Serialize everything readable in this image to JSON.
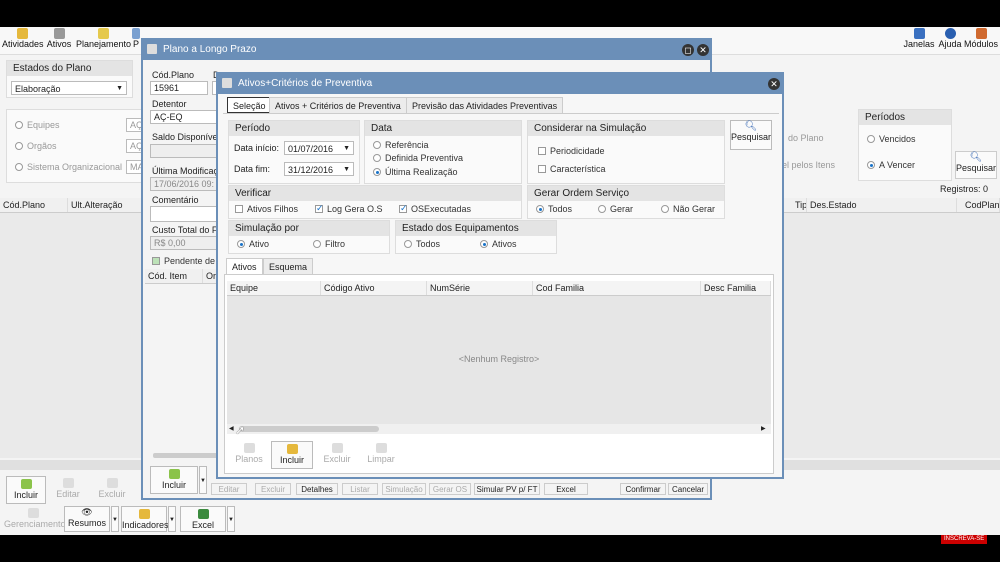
{
  "toolbar": {
    "left": [
      {
        "label": "Atividades",
        "icon": "activities-icon",
        "color": "#e5b83c"
      },
      {
        "label": "Ativos",
        "icon": "assets-icon",
        "color": "#999999"
      },
      {
        "label": "Planejamento",
        "icon": "planning-icon",
        "color": "#e5c94c"
      },
      {
        "label": "P",
        "icon": "more-icon",
        "color": "#7aa0d0"
      }
    ],
    "right": [
      {
        "label": "Janelas",
        "icon": "windows-icon",
        "color": "#3a70c0"
      },
      {
        "label": "Ajuda",
        "icon": "help-icon",
        "color": "#2a5fb0"
      },
      {
        "label": "Módulos",
        "icon": "modules-icon",
        "color": "#d06a30"
      }
    ]
  },
  "main": {
    "estados": {
      "title": "Estados do Plano",
      "value": "Elaboração"
    },
    "left_options": [
      "Equipes",
      "Orgãos",
      "Sistema Organizacional"
    ],
    "left_fields": [
      "AÇ",
      "AÇ",
      "MA"
    ],
    "right_partial_1": "do Plano",
    "right_partial_2": "el pelos Itens",
    "periodos": {
      "title": "Períodos",
      "options": [
        {
          "label": "Vencidos",
          "on": false
        },
        {
          "label": "A Vencer",
          "on": true
        }
      ]
    },
    "pesquisar": "Pesquisar",
    "registros": "Registros: 0",
    "columns_left": [
      "Cód.Plano",
      "Ult.Alteração"
    ],
    "columns_right": [
      "Tip",
      "Des.Estado",
      "CodPlano"
    ],
    "bottom_buttons": [
      {
        "label": "Incluir",
        "enabled": true
      },
      {
        "label": "Editar",
        "enabled": false
      },
      {
        "label": "Excluir",
        "enabled": false
      }
    ],
    "bottom_buttons_2": [
      {
        "label": "Gerenciamento",
        "enabled": false
      },
      {
        "label": "Resumos",
        "enabled": true
      },
      {
        "label": "Indicadores",
        "enabled": true
      },
      {
        "label": "Excel",
        "enabled": true
      }
    ]
  },
  "plan_window": {
    "title": "Plano a Longo Prazo",
    "cod_label": "Cód.Plano",
    "cod_value": "15961",
    "desc_label": "D",
    "detentor_label": "Detentor",
    "detentor_value": "AÇ-EQ",
    "saldo_label": "Saldo Disponível",
    "ultima_label": "Última Modificaç",
    "ultima_value": "17/06/2016 09:",
    "comentario_label": "Comentário",
    "custo_label": "Custo Total do F",
    "custo_value": "R$ 0,00",
    "pendente_label": "Pendente de",
    "grid_cols": [
      "Cód. Item",
      "Ori"
    ],
    "incluir": "Incluir",
    "actions": [
      {
        "label": "Editar",
        "enabled": false
      },
      {
        "label": "Excluir",
        "enabled": false
      },
      {
        "label": "Detalhes",
        "enabled": true
      },
      {
        "label": "Listar",
        "enabled": false
      },
      {
        "label": "Simulação",
        "enabled": false
      },
      {
        "label": "Gerar OS",
        "enabled": false
      },
      {
        "label": "Simular PV p/ FT",
        "enabled": true
      },
      {
        "label": "Excel",
        "enabled": true
      },
      {
        "label": "Confirmar",
        "enabled": true
      },
      {
        "label": "Cancelar",
        "enabled": true
      }
    ]
  },
  "dialog": {
    "title": "Ativos+Critérios de Preventiva",
    "tabs": [
      {
        "label": "Seleção",
        "active": true
      },
      {
        "label": "Ativos + Critérios de Preventiva",
        "active": false
      },
      {
        "label": "Previsão das Atividades Preventivas",
        "active": false
      }
    ],
    "periodo": {
      "title": "Período",
      "start_label": "Data início:",
      "start_value": "01/07/2016",
      "end_label": "Data fim:",
      "end_value": "31/12/2016"
    },
    "data": {
      "title": "Data",
      "options": [
        {
          "label": "Referência",
          "on": false
        },
        {
          "label": "Definida Preventiva",
          "on": false
        },
        {
          "label": "Última Realização",
          "on": true
        }
      ]
    },
    "considerar": {
      "title": "Considerar na Simulação",
      "options": [
        {
          "label": "Periodicidade",
          "on": false
        },
        {
          "label": "Característica",
          "on": false
        }
      ]
    },
    "pesquisar": "Pesquisar",
    "verificar": {
      "title": "Verificar",
      "options": [
        {
          "label": "Ativos Filhos",
          "on": false
        },
        {
          "label": "Log Gera O.S",
          "on": true
        },
        {
          "label": "OSExecutadas",
          "on": true
        }
      ]
    },
    "gerar": {
      "title": "Gerar Ordem Serviço",
      "options": [
        {
          "label": "Todos",
          "on": true
        },
        {
          "label": "Gerar",
          "on": false
        },
        {
          "label": "Não Gerar",
          "on": false
        }
      ]
    },
    "simulacao": {
      "title": "Simulação por",
      "options": [
        {
          "label": "Ativo",
          "on": true
        },
        {
          "label": "Filtro",
          "on": false
        }
      ]
    },
    "estado": {
      "title": "Estado dos Equipamentos",
      "options": [
        {
          "label": "Todos",
          "on": false
        },
        {
          "label": "Ativos",
          "on": true
        }
      ]
    },
    "subtabs": [
      {
        "label": "Ativos",
        "active": true
      },
      {
        "label": "Esquema",
        "active": false
      }
    ],
    "grid_cols": [
      "Equipe",
      "Código Ativo",
      "NumSérie",
      "Cod Familia",
      "Desc Familia"
    ],
    "empty": "<Nenhum Registro>",
    "buttons": [
      {
        "label": "Planos",
        "enabled": false
      },
      {
        "label": "Incluir",
        "enabled": true
      },
      {
        "label": "Excluir",
        "enabled": false
      },
      {
        "label": "Limpar",
        "enabled": false
      }
    ]
  },
  "watermark": "INSCREVA-SE"
}
